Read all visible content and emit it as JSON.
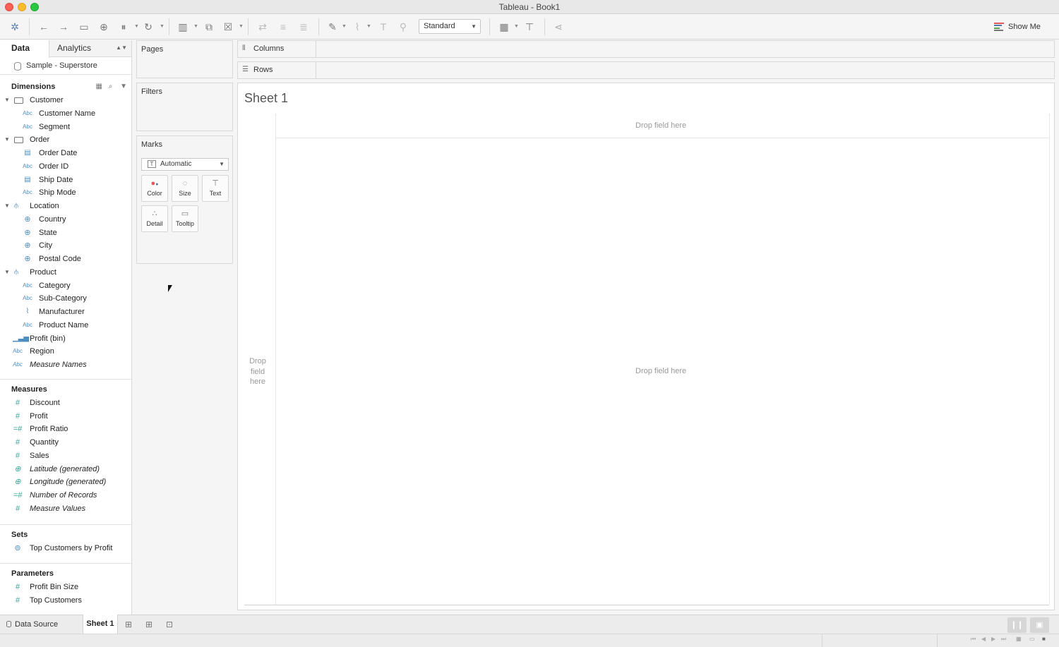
{
  "window": {
    "title": "Tableau - Book1"
  },
  "toolbar": {
    "view_select": "Standard",
    "show_me_label": "Show Me"
  },
  "datapane": {
    "tabs": {
      "data": "Data",
      "analytics": "Analytics"
    },
    "datasource": "Sample - Superstore",
    "dimensions_title": "Dimensions",
    "dimensions": [
      {
        "label": "Customer",
        "type": "folder"
      },
      {
        "label": "Customer Name",
        "type": "abc"
      },
      {
        "label": "Segment",
        "type": "abc"
      },
      {
        "label": "Order",
        "type": "folder"
      },
      {
        "label": "Order Date",
        "type": "date"
      },
      {
        "label": "Order ID",
        "type": "abc"
      },
      {
        "label": "Ship Date",
        "type": "date"
      },
      {
        "label": "Ship Mode",
        "type": "abc"
      },
      {
        "label": "Location",
        "type": "hierarchy"
      },
      {
        "label": "Country",
        "type": "geo"
      },
      {
        "label": "State",
        "type": "geo"
      },
      {
        "label": "City",
        "type": "geo"
      },
      {
        "label": "Postal Code",
        "type": "geo"
      },
      {
        "label": "Product",
        "type": "hierarchy"
      },
      {
        "label": "Category",
        "type": "abc"
      },
      {
        "label": "Sub-Category",
        "type": "abc"
      },
      {
        "label": "Manufacturer",
        "type": "clip"
      },
      {
        "label": "Product Name",
        "type": "abc"
      },
      {
        "label": "Profit (bin)",
        "type": "bin"
      },
      {
        "label": "Region",
        "type": "abc"
      },
      {
        "label": "Measure Names",
        "type": "abc"
      }
    ],
    "measures_title": "Measures",
    "measures": [
      {
        "label": "Discount",
        "type": "measure"
      },
      {
        "label": "Profit",
        "type": "measure"
      },
      {
        "label": "Profit Ratio",
        "type": "calc"
      },
      {
        "label": "Quantity",
        "type": "measure"
      },
      {
        "label": "Sales",
        "type": "measure"
      },
      {
        "label": "Latitude (generated)",
        "type": "geo"
      },
      {
        "label": "Longitude (generated)",
        "type": "geo"
      },
      {
        "label": "Number of Records",
        "type": "calc"
      },
      {
        "label": "Measure Values",
        "type": "measure"
      }
    ],
    "sets_title": "Sets",
    "sets": [
      {
        "label": "Top Customers by Profit"
      }
    ],
    "parameters_title": "Parameters",
    "parameters": [
      {
        "label": "Profit Bin Size"
      },
      {
        "label": "Top Customers"
      }
    ],
    "abc_tag": "Abc"
  },
  "shelves": {
    "pages": "Pages",
    "filters": "Filters",
    "marks": "Marks",
    "mark_type": "Automatic",
    "mark_buttons": {
      "color": "Color",
      "size": "Size",
      "text": "Text",
      "detail": "Detail",
      "tooltip": "Tooltip"
    },
    "columns": "Columns",
    "rows": "Rows"
  },
  "canvas": {
    "sheet_title": "Sheet 1",
    "drop_top": "Drop field here",
    "drop_center": "Drop field here",
    "drop_left": "Drop field here"
  },
  "bottom": {
    "data_source_tab": "Data Source",
    "sheet_tab": "Sheet 1"
  }
}
